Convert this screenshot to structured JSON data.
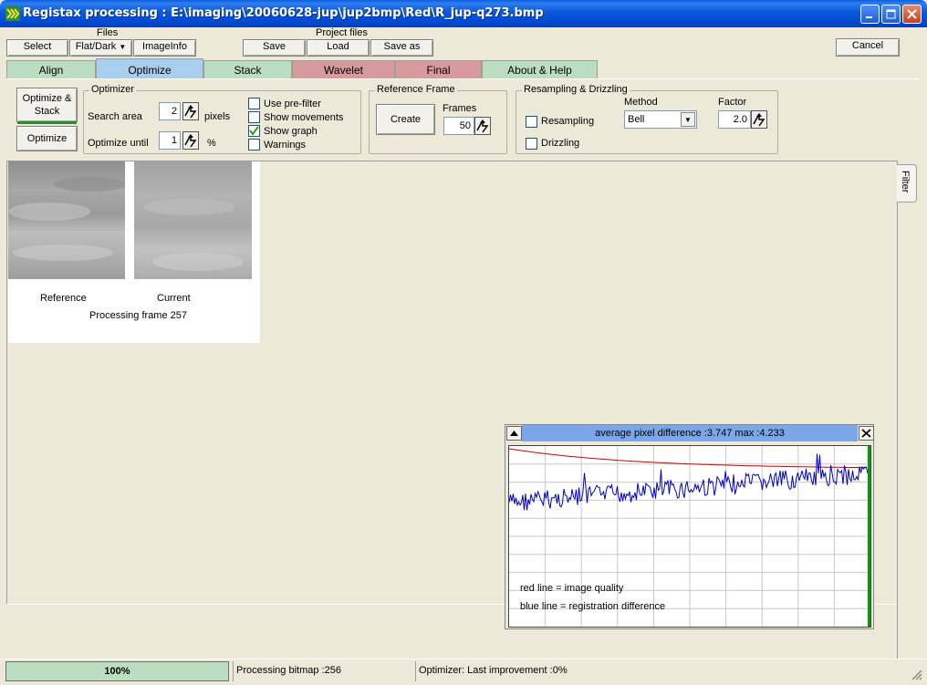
{
  "window": {
    "title": "Registax processing : E:\\imaging\\20060628-jup\\jup2bmp\\Red\\R_jup-q273.bmp"
  },
  "toolbar": {
    "files_label": "Files",
    "select": "Select",
    "flat_dark": "Flat/Dark",
    "imageinfo": "ImageInfo",
    "project_files_label": "Project files",
    "save": "Save",
    "load": "Load",
    "save_as": "Save as",
    "cancel": "Cancel"
  },
  "tabs": [
    {
      "label": "Align",
      "color": "#BCDEC0"
    },
    {
      "label": "Optimize",
      "color": "#A9CFEF",
      "selected": true
    },
    {
      "label": "Stack",
      "color": "#BCDEC0"
    },
    {
      "label": "Wavelet",
      "color": "#D79A9D"
    },
    {
      "label": "Final",
      "color": "#D79A9D"
    },
    {
      "label": "About & Help",
      "color": "#BCDEC0"
    }
  ],
  "optimize_controls": {
    "optimize_stack": "Optimize & Stack",
    "optimize": "Optimize"
  },
  "optimizer": {
    "title": "Optimizer",
    "search_area_label": "Search area",
    "search_area_value": "2",
    "search_area_unit": "pixels",
    "optimize_until_label": "Optimize until",
    "optimize_until_value": "1",
    "optimize_until_unit": "%",
    "options": [
      {
        "label": "Use pre-filter",
        "checked": false
      },
      {
        "label": "Show movements",
        "checked": false
      },
      {
        "label": "Show graph",
        "checked": true
      },
      {
        "label": "Warnings",
        "checked": false
      }
    ]
  },
  "reference_frame": {
    "title": "Reference  Frame",
    "create": "Create",
    "frames_label": "Frames",
    "frames_value": "50"
  },
  "resampling": {
    "title": "Resampling & Drizzling",
    "resampling_label": "Resampling",
    "resampling_checked": false,
    "drizzling_label": "Drizzling",
    "drizzling_checked": false,
    "method_label": "Method",
    "method_value": "Bell",
    "factor_label": "Factor",
    "factor_value": "2.0"
  },
  "preview": {
    "reference_label": "Reference",
    "current_label": "Current",
    "processing_text": "Processing frame 257"
  },
  "filter_tab": "Filter",
  "graph": {
    "header": "average pixel difference :3.747 max :4.233",
    "legend_red": "red  line = image quality",
    "legend_blue": "blue line = registration difference",
    "colors": {
      "quality": "#CC0000",
      "registration": "#0000CC",
      "progress": "#00A000"
    }
  },
  "status": {
    "progress": "100%",
    "progress_fraction": 1.0,
    "message1": "Processing bitmap :256",
    "message2": "Optimizer: Last improvement :0%"
  }
}
